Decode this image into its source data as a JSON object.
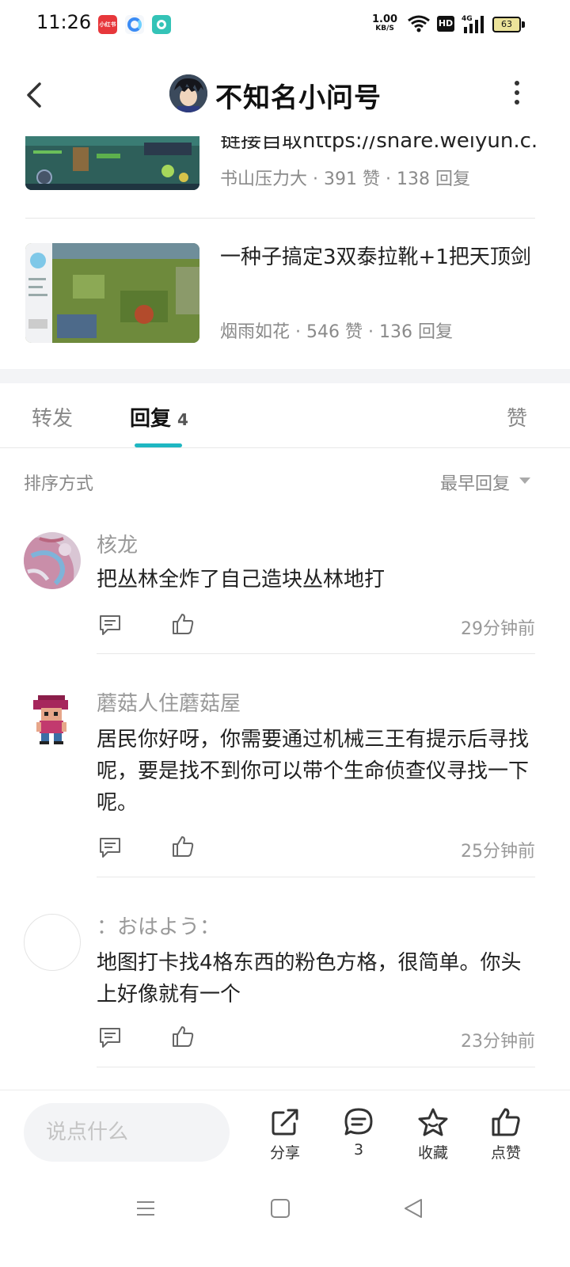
{
  "status_bar": {
    "time": "11:26",
    "app_icon_1_text": "小红书",
    "net_speed_value": "1.00",
    "net_speed_unit": "KB/S",
    "hd_label": "HD",
    "network": "4G",
    "battery": "63"
  },
  "header": {
    "title": "不知名小问号"
  },
  "related_posts": [
    {
      "title": "链接自取https://share.weiyun.c...",
      "author": "书山压力大",
      "likes": "391 赞",
      "replies": "138 回复"
    },
    {
      "title": "一种子搞定3双泰拉靴+1把天顶剑",
      "author": "烟雨如花",
      "likes": "546 赞",
      "replies": "136 回复"
    }
  ],
  "tabs": {
    "forward": "转发",
    "reply": "回复",
    "reply_count": "4",
    "like": "赞"
  },
  "sort": {
    "label": "排序方式",
    "value": "最早回复"
  },
  "comments": [
    {
      "name": "核龙",
      "text": "把丛林全炸了自己造块丛林地打",
      "time": "29分钟前"
    },
    {
      "name": "蘑菇人住蘑菇屋",
      "text": "居民你好呀，你需要通过机械三王有提示后寻找呢，要是找不到你可以带个生命侦查仪寻找一下呢。",
      "time": "25分钟前"
    },
    {
      "name": "：おはよう：",
      "text": "地图打卡找4格东西的粉色方格，很简单。你头上好像就有一个",
      "time": "23分钟前"
    }
  ],
  "action_bar": {
    "input_placeholder": "说点什么",
    "share": "分享",
    "comments_count": "3",
    "favorite": "收藏",
    "like": "点赞"
  },
  "colors": {
    "accent": "#1fb7c2",
    "text_primary": "#222222",
    "text_secondary": "#8a8a8a"
  }
}
